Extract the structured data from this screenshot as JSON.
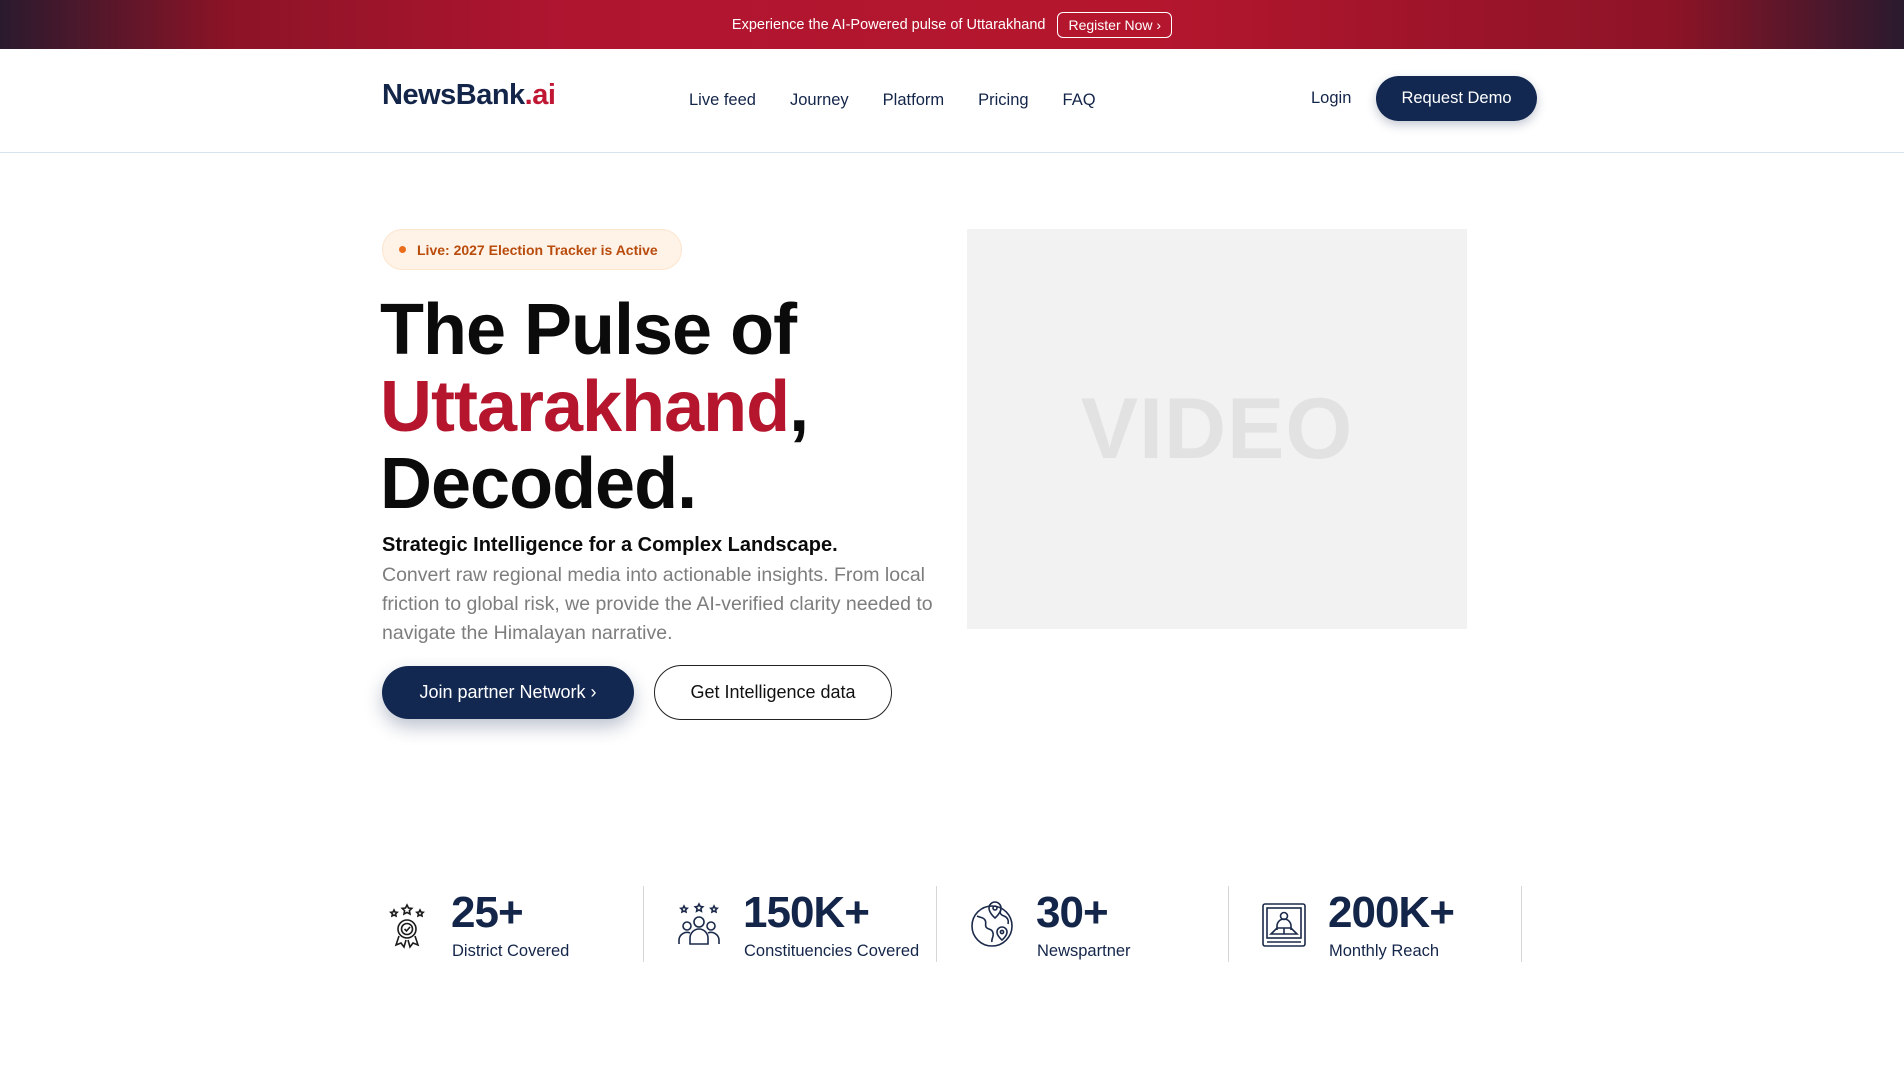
{
  "topbar": {
    "message": "Experience the AI-Powered pulse of Uttarakhand",
    "register_label": "Register Now ›"
  },
  "nav": {
    "logo_main": "NewsBank",
    "logo_suffix": ".ai",
    "items": [
      "Live feed",
      "Journey",
      "Platform",
      "Pricing",
      "FAQ"
    ],
    "login_label": "Login",
    "demo_label": "Request Demo"
  },
  "hero": {
    "badge": "Live: 2027 Election Tracker is Active",
    "title_line1": "The Pulse of",
    "title_highlight": "Uttarakhand",
    "title_comma": ",",
    "title_line3": "Decoded.",
    "subtitle": "Strategic Intelligence for a Complex Landscape.",
    "description": "Convert raw regional media into actionable insights. From local friction to global risk, we provide the AI-verified clarity needed to navigate the Himalayan narrative.",
    "join_label": "Join partner Network ›",
    "intel_label": "Get Intelligence data",
    "video_placeholder": "VIDEO"
  },
  "stats": [
    {
      "value": "25+",
      "label": "District Covered",
      "icon": "award-medal-icon"
    },
    {
      "value": "150K+",
      "label": "Constituencies Covered",
      "icon": "people-group-icon"
    },
    {
      "value": "30+",
      "label": "Newspartner",
      "icon": "globe-location-icon"
    },
    {
      "value": "200K+",
      "label": "Monthly Reach",
      "icon": "reader-screen-icon"
    }
  ],
  "colors": {
    "brand_navy": "#122851",
    "brand_red": "#b5162e",
    "badge_text": "#b94c0c"
  }
}
